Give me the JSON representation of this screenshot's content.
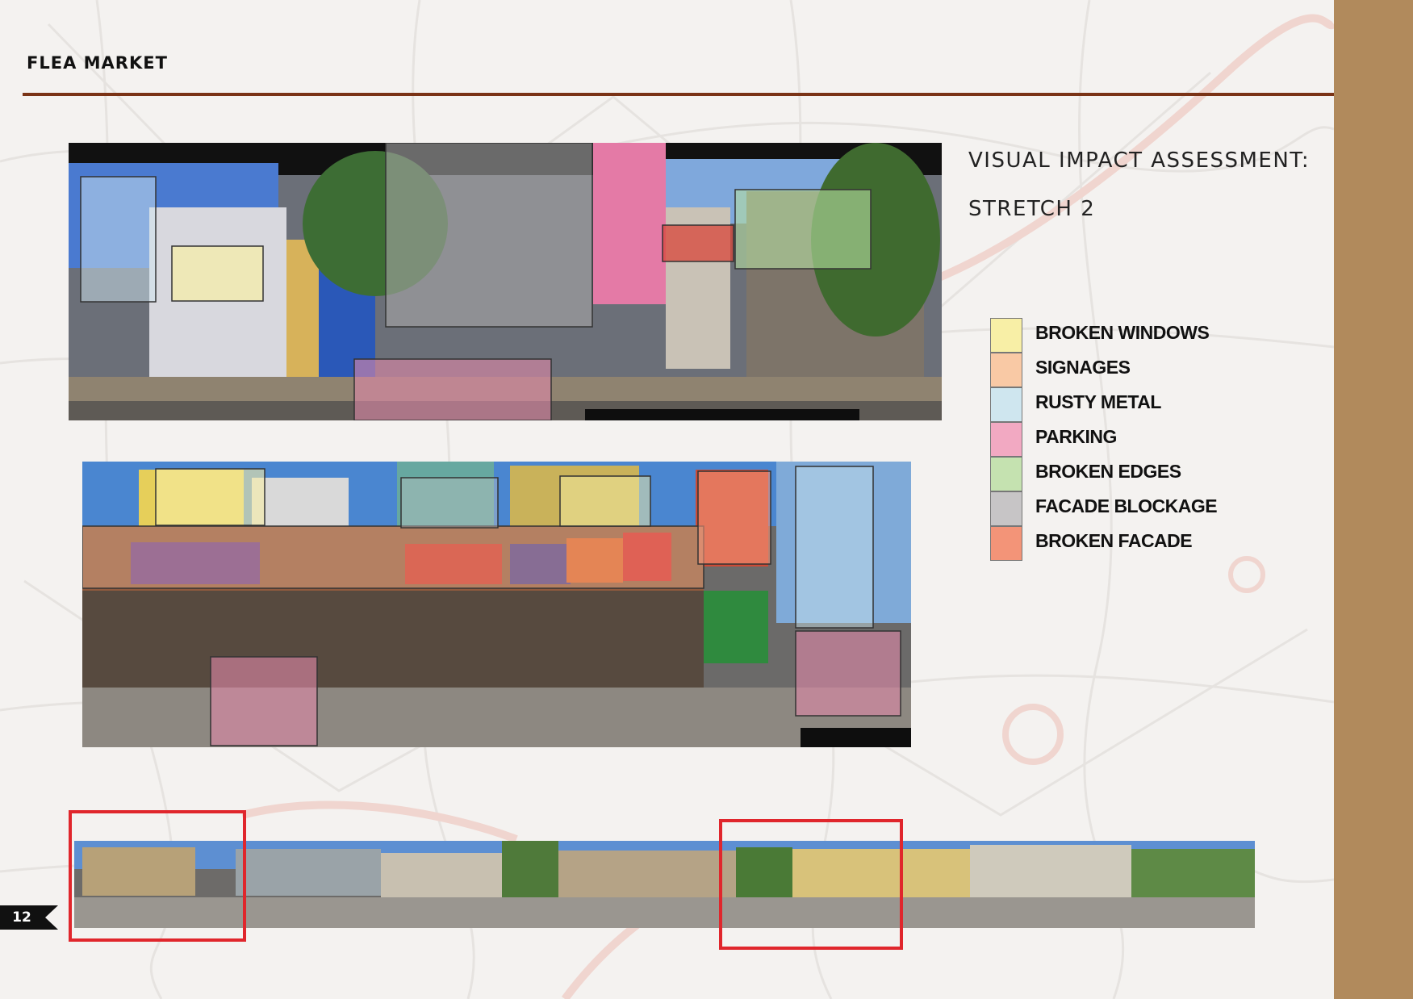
{
  "document": {
    "title": "FLEA MARKET",
    "page_number": "12"
  },
  "assessment": {
    "heading": "VISUAL IMPACT ASSESSMENT:",
    "subheading": "STRETCH 2"
  },
  "legend": [
    {
      "label": "BROKEN WINDOWS",
      "color": "#f8efa6"
    },
    {
      "label": "SIGNAGES",
      "color": "#f9c9a5"
    },
    {
      "label": "RUSTY METAL",
      "color": "#cfe6ef"
    },
    {
      "label": "PARKING",
      "color": "#f2a9c2"
    },
    {
      "label": "BROKEN EDGES",
      "color": "#c5e2b0"
    },
    {
      "label": "FACADE BLOCKAGE",
      "color": "#c7c5c6"
    },
    {
      "label": "BROKEN FACADE",
      "color": "#f39478"
    }
  ],
  "colors": {
    "accent_rule": "#7a3316",
    "side_band": "#b18a5c",
    "highlight": "#e0262c"
  }
}
